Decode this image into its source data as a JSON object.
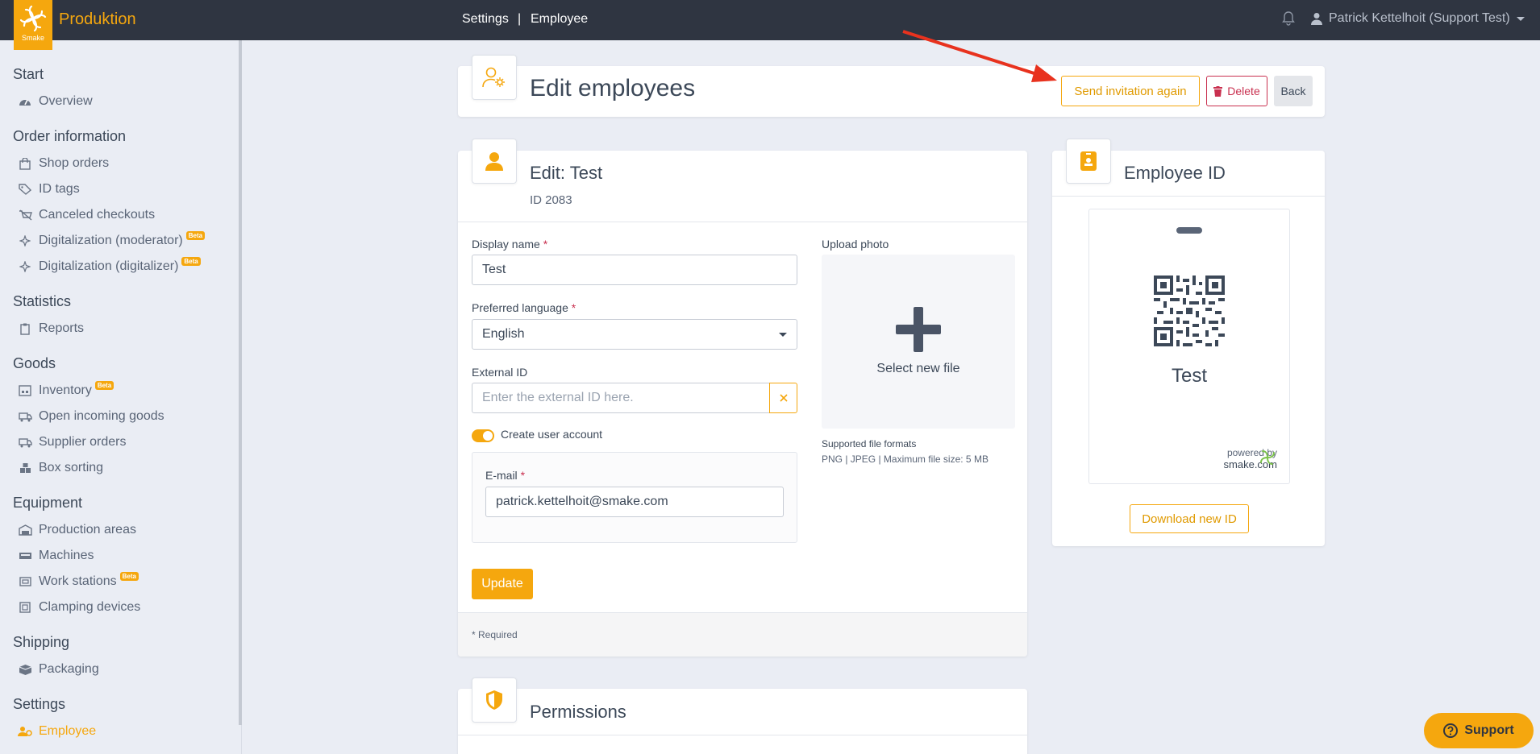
{
  "app": {
    "name": "Produktion",
    "logo_text": "Smake"
  },
  "breadcrumb": {
    "first": "Settings",
    "sep": "|",
    "second": "Employee"
  },
  "user": {
    "name": "Patrick Kettelhoit (Support Test)"
  },
  "sidebar": {
    "sections": [
      {
        "title": "Start"
      },
      {
        "title": "Order information"
      },
      {
        "title": "Statistics"
      },
      {
        "title": "Goods"
      },
      {
        "title": "Equipment"
      },
      {
        "title": "Shipping"
      },
      {
        "title": "Settings"
      }
    ],
    "items": {
      "overview": "Overview",
      "shop_orders": "Shop orders",
      "id_tags": "ID tags",
      "canceled_checkouts": "Canceled checkouts",
      "digi_moderator": "Digitalization (moderator)",
      "digi_digitalizer": "Digitalization (digitalizer)",
      "reports": "Reports",
      "inventory": "Inventory",
      "open_incoming": "Open incoming goods",
      "supplier_orders": "Supplier orders",
      "box_sorting": "Box sorting",
      "production_areas": "Production areas",
      "machines": "Machines",
      "work_stations": "Work stations",
      "clamping_devices": "Clamping devices",
      "packaging": "Packaging",
      "employee": "Employee"
    },
    "beta": "Beta"
  },
  "header": {
    "title": "Edit employees",
    "send_invitation": "Send invitation again",
    "delete": "Delete",
    "back": "Back"
  },
  "edit": {
    "title": "Edit: Test",
    "id": "ID 2083",
    "display_name_label": "Display name",
    "display_name_value": "Test",
    "language_label": "Preferred language",
    "language_value": "English",
    "external_id_label": "External ID",
    "external_id_placeholder": "Enter the external ID here.",
    "create_account_label": "Create user account",
    "email_label": "E-mail",
    "email_value": "patrick.kettelhoit@smake.com",
    "update": "Update",
    "required_note": "* Required",
    "req_mark": "*",
    "upload_label": "Upload photo",
    "select_file": "Select new file",
    "formats_title": "Supported file formats",
    "formats_text": "PNG | JPEG | Maximum file size: 5 MB"
  },
  "employee_id": {
    "title": "Employee ID",
    "name": "Test",
    "powered_by": "powered by",
    "site": "smake.com",
    "download": "Download new ID"
  },
  "permissions": {
    "title": "Permissions"
  },
  "support": {
    "label": "Support"
  },
  "colors": {
    "accent": "#f5a70e",
    "topbar": "#2f3541",
    "danger": "#c9304f",
    "arrow": "#e8321e"
  }
}
